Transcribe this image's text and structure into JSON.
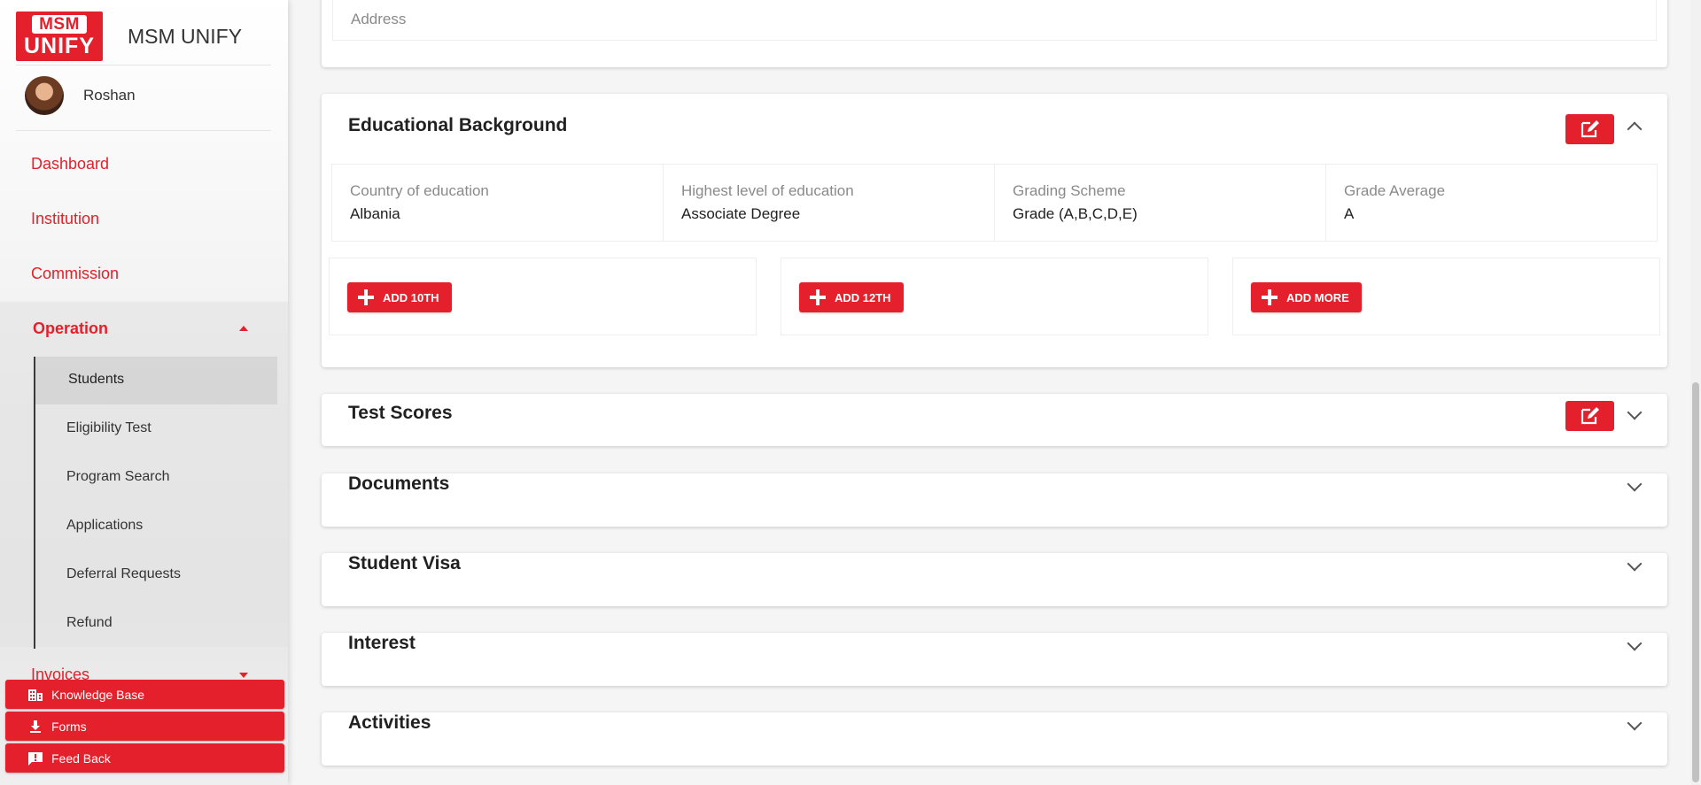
{
  "app": {
    "logo_line1": "MSM",
    "logo_line2": "UNIFY",
    "name": "MSM UNIFY"
  },
  "user": {
    "name": "Roshan"
  },
  "nav": {
    "dashboard": "Dashboard",
    "institution": "Institution",
    "commission": "Commission",
    "operation": "Operation",
    "operation_items": [
      "Students",
      "Eligibility Test",
      "Program Search",
      "Applications",
      "Deferral Requests",
      "Refund"
    ],
    "invoices": "Invoices"
  },
  "sidebar_buttons": {
    "knowledge_base": "Knowledge Base",
    "forms": "Forms",
    "feedback": "Feed Back"
  },
  "address": {
    "label": "Address"
  },
  "educational_background": {
    "title": "Educational Background",
    "fields": [
      {
        "label": "Country of education",
        "value": "Albania"
      },
      {
        "label": "Highest level of education",
        "value": "Associate Degree"
      },
      {
        "label": "Grading Scheme",
        "value": "Grade (A,B,C,D,E)"
      },
      {
        "label": "Grade Average",
        "value": "A"
      }
    ],
    "add_buttons": [
      "ADD 10TH",
      "ADD 12TH",
      "ADD MORE"
    ]
  },
  "sections": {
    "test_scores": "Test Scores",
    "documents": "Documents",
    "student_visa": "Student Visa",
    "interest": "Interest",
    "activities": "Activities"
  },
  "colors": {
    "accent": "#e3202b",
    "background": "#f5f5f5"
  },
  "icons": {
    "edit": "edit-icon",
    "expand": "chevron-down-icon",
    "collapse": "chevron-up-icon",
    "knowledge_base": "building-icon",
    "forms": "download-icon",
    "feedback": "feedback-icon",
    "add": "plus-icon"
  }
}
